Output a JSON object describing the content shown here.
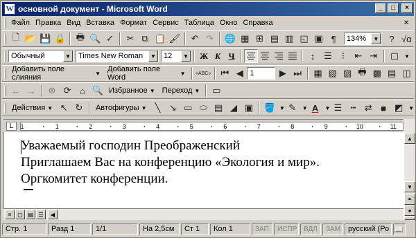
{
  "window": {
    "title": "основной документ - Microsoft Word",
    "controls": [
      "_",
      "□",
      "×"
    ]
  },
  "menubar": {
    "items": [
      "Файл",
      "Правка",
      "Вид",
      "Вставка",
      "Формат",
      "Сервис",
      "Таблица",
      "Окно",
      "Справка"
    ]
  },
  "standard_toolbar": {
    "zoom": "134%"
  },
  "formatting_toolbar": {
    "style": "Обычный",
    "font": "Times New Roman",
    "size": "12",
    "bold": "Ж",
    "italic": "К",
    "underline": "Ч"
  },
  "mailmerge_toolbar": {
    "insert_merge_field": "Добавить поле слияния",
    "insert_word_field": "Добавить поле Word",
    "abc_label": "«ABC»",
    "record": "1"
  },
  "web_toolbar": {
    "favorites": "Избранное",
    "go": "Переход"
  },
  "drawing_toolbar": {
    "actions": "Действия",
    "autoshapes": "Автофигуры"
  },
  "ruler": {
    "marks": [
      "1",
      "1",
      "2",
      "3",
      "4",
      "5",
      "6",
      "7",
      "8",
      "9",
      "10",
      "11"
    ]
  },
  "document": {
    "lines": [
      "Уважаемый господин Преображенский",
      "Приглашаем Вас на конференцию «Экология и мир».",
      "Оргкомитет конференции."
    ]
  },
  "statusbar": {
    "page": "Стр. 1",
    "section": "Разд 1",
    "pages": "1/1",
    "at": "На 2,5см",
    "line": "Ст 1",
    "col": "Кол 1",
    "rec": "ЗАП",
    "trk": "ИСПР",
    "ext": "ВДЛ",
    "ovr": "ЗАМ",
    "language": "русский (Ро"
  }
}
